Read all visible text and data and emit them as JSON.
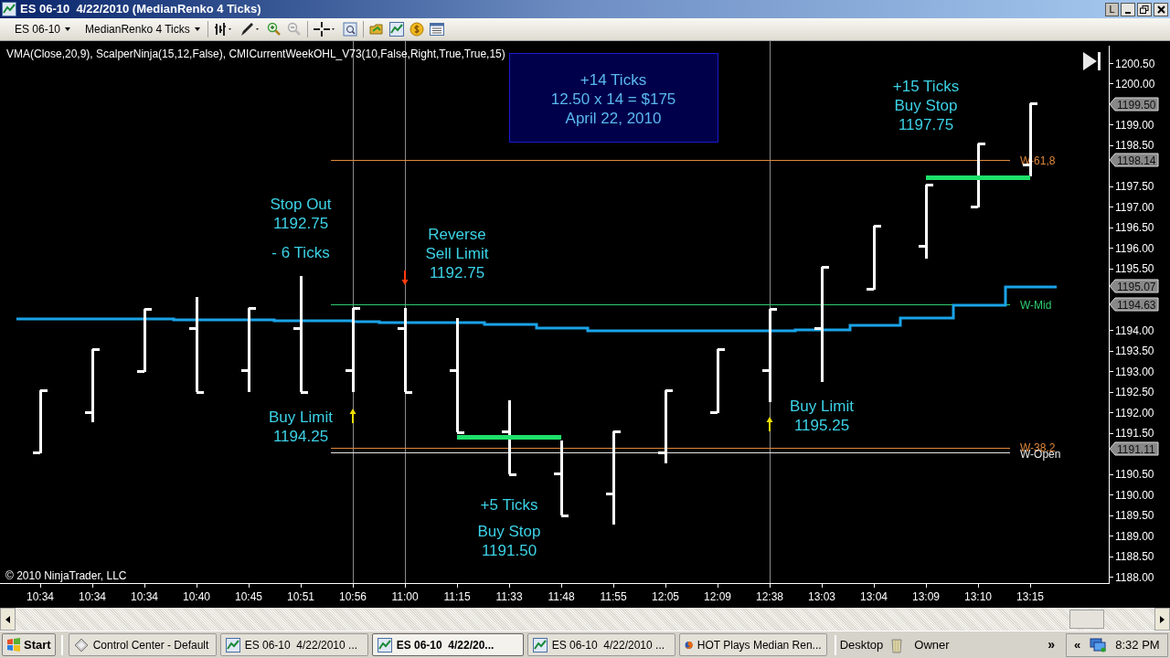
{
  "window": {
    "title": "ES 06-10  4/22/2010 (MedianRenko 4 Ticks)",
    "buttons": [
      "L"
    ]
  },
  "toolbar": {
    "instrument": "ES 06-10",
    "bar_type": "MedianRenko 4 Ticks"
  },
  "chart": {
    "indicators": "VMA(Close,20,9), ScalperNinja(15,12,False), CMICurrentWeekOHL_V73(10,False,Right,True,True,15)",
    "info_box": [
      "+14 Ticks",
      "12.50 x 14 = $175",
      "April 22, 2010"
    ],
    "annotations": [
      {
        "lines": [
          "Stop Out",
          "1192.75"
        ]
      },
      {
        "lines": [
          "- 6 Ticks"
        ]
      },
      {
        "lines": [
          "Reverse",
          "Sell Limit",
          "1192.75"
        ]
      },
      {
        "lines": [
          "Buy Limit",
          "1194.25"
        ]
      },
      {
        "lines": [
          "+5 Ticks"
        ]
      },
      {
        "lines": [
          "Buy Stop",
          "1191.50"
        ]
      },
      {
        "lines": [
          "Buy Limit",
          "1195.25"
        ]
      },
      {
        "lines": [
          "+15 Ticks",
          "Buy Stop",
          "1197.75"
        ]
      }
    ],
    "level_lines": [
      {
        "label": "W-61,8",
        "color": "#e0883a"
      },
      {
        "label": "W-Mid",
        "color": "#2ecc71"
      },
      {
        "label": "W-38.2",
        "color": "#e0883a"
      },
      {
        "label": "W-Open",
        "color": "#e8e8e8"
      }
    ],
    "price_ticks": [
      "1200.50",
      "1200.00",
      "1199.00",
      "1198.50",
      "1197.50",
      "1197.00",
      "1196.50",
      "1196.00",
      "1195.50",
      "1194.00",
      "1193.50",
      "1193.00",
      "1192.50",
      "1192.00",
      "1191.50",
      "1190.50",
      "1190.00",
      "1189.50",
      "1189.00",
      "1188.50",
      "1188.00"
    ],
    "price_markers": [
      "1199.50",
      "1198.14",
      "1195.07",
      "1194.63",
      "1191.11"
    ],
    "time_ticks": [
      "10:34",
      "10:34",
      "10:34",
      "10:40",
      "10:45",
      "10:51",
      "10:56",
      "11:00",
      "11:15",
      "11:33",
      "11:48",
      "11:55",
      "12:05",
      "12:09",
      "12:38",
      "13:03",
      "13:04",
      "13:09",
      "13:10",
      "13:15"
    ],
    "copyright": "© 2010 NinjaTrader, LLC"
  },
  "taskbar": {
    "start": "Start",
    "items": [
      {
        "label": "Control Center - Default",
        "kind": "app",
        "selected": false
      },
      {
        "label": "ES 06-10  4/22/2010 ...",
        "kind": "chart",
        "selected": false
      },
      {
        "label": "ES 06-10  4/22/20...",
        "kind": "chart",
        "selected": true
      },
      {
        "label": "ES 06-10  4/22/2010 ...",
        "kind": "chart",
        "selected": false
      },
      {
        "label": "HOT Plays Median Ren...",
        "kind": "browser",
        "selected": false
      }
    ],
    "desktop": "Desktop",
    "owner": "Owner",
    "expand": "»",
    "tray_expand": "«",
    "clock": "8:32 PM"
  }
}
